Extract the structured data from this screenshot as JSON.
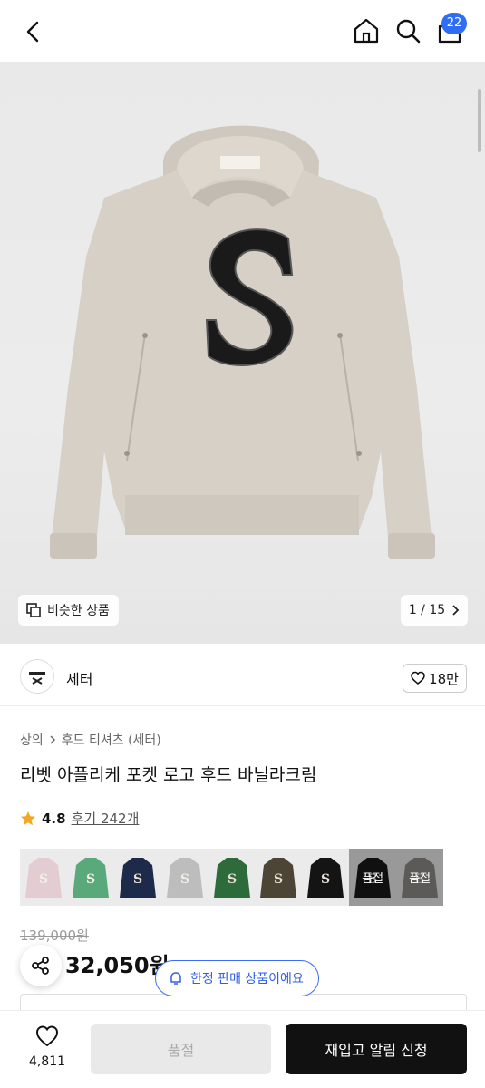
{
  "header": {
    "back_icon": "chevron-left-icon",
    "home_icon": "home-icon",
    "search_icon": "search-icon",
    "cart_icon": "shopping-bag-icon",
    "cart_count": "22"
  },
  "gallery": {
    "similar_label": "비슷한 상품",
    "page_counter": "1 / 15",
    "next_icon": "chevron-right-icon"
  },
  "brand": {
    "name": "세터",
    "likes": "18만"
  },
  "product": {
    "breadcrumb": [
      "상의",
      "후드 티셔츠 (세터)"
    ],
    "title": "리벳 아플리케 포켓 로고 후드 바닐라크림",
    "rating": "4.8",
    "reviews": "후기 242개",
    "colors": {
      "accent": "#2f6df6",
      "star": "#f5a623"
    },
    "swatches": [
      {
        "color": "#e3cdd2",
        "soldout": ""
      },
      {
        "color": "#5aa97a",
        "soldout": ""
      },
      {
        "color": "#1e2a4a",
        "soldout": ""
      },
      {
        "color": "#bdbdbd",
        "soldout": ""
      },
      {
        "color": "#2e6b3a",
        "soldout": ""
      },
      {
        "color": "#4c4536",
        "soldout": ""
      },
      {
        "color": "#141414",
        "soldout": ""
      },
      {
        "color": "#1a1a1a",
        "soldout": "품절"
      },
      {
        "color": "#8e8a85",
        "soldout": "품절"
      }
    ],
    "original_price": "139,000원",
    "sale_price": "32,050원",
    "limited_notice": "한정 판매 상품이에요"
  },
  "bottom_bar": {
    "like_count": "4,811",
    "soldout_label": "품절",
    "restock_label": "재입고 알림 신청"
  }
}
